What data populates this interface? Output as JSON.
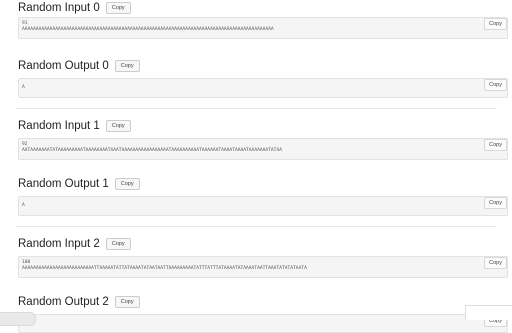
{
  "copy_label": "Copy",
  "sections": [
    {
      "title": "Random Input 0",
      "lines": [
        "91",
        "AAAAAAAAAAAAAAAAAAAAAAAAAAAAAAAAAAAAAAAAAAAAAAAAAAAAAAAAAAAAAAAAAAAAAAAAAAAAAAAAAAAAAAAAAAA"
      ]
    },
    {
      "title": "Random Output 0",
      "lines": [
        "A"
      ]
    },
    {
      "title": "Random Input 1",
      "lines": [
        "92",
        "AATAAAAAAATATAAAAAAAAATAAAAAAAATAAATAAAAAAAAAAAAAAAAATAAAAAAAAAATAAAAAATAAAATAAAATAAAAAAATATAA"
      ]
    },
    {
      "title": "Random Output 1",
      "lines": [
        "A"
      ]
    },
    {
      "title": "Random Input 2",
      "lines": [
        "100",
        "AAAAAAAAAAAAAAAAAAAAAAAAAATTAAAAATATTATAAAATATAATAATTAAAAAAAAATATTTATTTATAAAATATAAAATAATTAAATATATATAATA"
      ]
    },
    {
      "title": "Random Output 2",
      "lines": [
        ""
      ]
    }
  ]
}
